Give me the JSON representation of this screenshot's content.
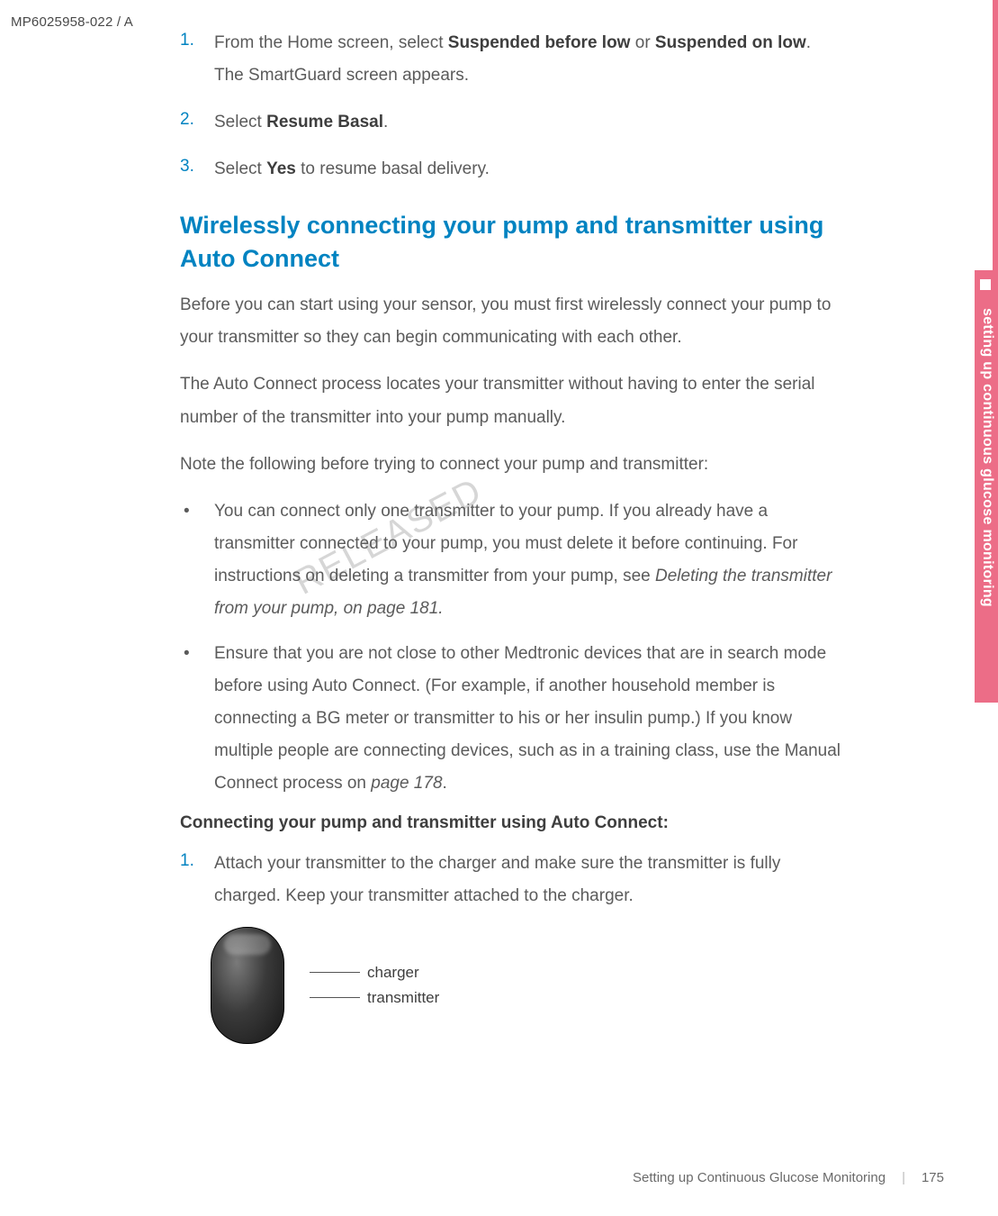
{
  "doc_code": "MP6025958-022 / A",
  "steps_top": [
    {
      "num": "1.",
      "prefix": "From the Home screen, select ",
      "b1": "Suspended before low",
      "mid": " or ",
      "b2": "Suspended on low",
      "suffix": ".",
      "line2": "The SmartGuard screen appears."
    },
    {
      "num": "2.",
      "prefix": "Select ",
      "b1": "Resume Basal",
      "suffix": "."
    },
    {
      "num": "3.",
      "prefix": "Select ",
      "b1": "Yes",
      "suffix": " to resume basal delivery."
    }
  ],
  "heading": "Wirelessly connecting your pump and transmitter using Auto Connect",
  "para1": "Before you can start using your sensor, you must first wirelessly connect your pump to your transmitter so they can begin communicating with each other.",
  "para2": "The Auto Connect process locates your transmitter without having to enter the serial number of the transmitter into your pump manually.",
  "para3": "Note the following before trying to connect your pump and transmitter:",
  "bullets": [
    {
      "t1": "You can connect only one transmitter to your pump. If you already have a transmitter connected to your pump, you must delete it before continuing. For instructions on deleting a transmitter from your pump, see ",
      "i1": "Deleting the transmitter from your pump, on page 181.",
      "t2": ""
    },
    {
      "t1": "Ensure that you are not close to other Medtronic devices that are in search mode before using Auto Connect. (For example, if another household member is connecting a BG meter or transmitter to his or her insulin pump.) If you know multiple people are connecting devices, such as in a training class, use the Manual Connect process on ",
      "i1": "page 178",
      "t2": "."
    }
  ],
  "subheading": "Connecting your pump and transmitter using Auto Connect:",
  "steps_bottom": [
    {
      "num": "1.",
      "text": "Attach your transmitter to the charger and make sure the transmitter is fully charged. Keep your transmitter attached to the charger."
    }
  ],
  "figure": {
    "label_charger": "charger",
    "label_transmitter": "transmitter"
  },
  "watermark": "RELEASED",
  "side_tab": {
    "text": "setting up continuous glucose monitoring"
  },
  "footer": {
    "section": "Setting up Continuous Glucose Monitoring",
    "page": "175"
  }
}
